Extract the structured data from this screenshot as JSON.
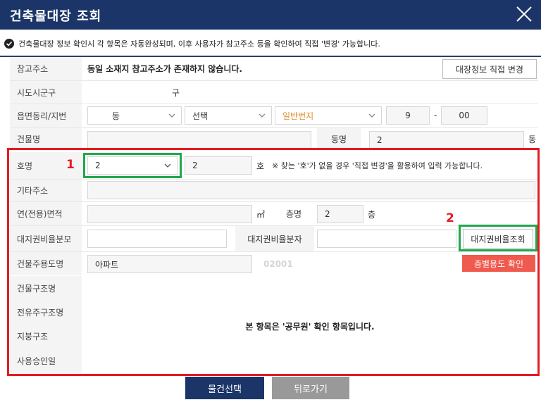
{
  "window": {
    "title": "건축물대장 조회",
    "close_icon": "close-icon"
  },
  "notice": "건축물대장 정보 확인시 각 항목은 자동완성되며, 이후 사용자가 참고주소 등을 확인하여 직접 '변경' 가능합니다.",
  "rows": {
    "ref_address": {
      "label": "참고주소",
      "value": "동일 소재지 참고주소가 존재하지 않습니다.",
      "button": "대장정보 직접 변경"
    },
    "sido": {
      "label": "시도시군구",
      "value": "구"
    },
    "eup": {
      "label": "읍면동리/지번",
      "dong_select": "동",
      "type_select": "선택",
      "lot_select": "일반번지",
      "main_no": "9",
      "dash": "-",
      "sub_no": "00"
    },
    "building_name": {
      "label": "건물명",
      "value": "",
      "dong_label": "동명",
      "dong_value": "2",
      "dong_suffix": "동"
    },
    "ho": {
      "label": "호명",
      "select_value": "2",
      "input_value": "2",
      "suffix": "호",
      "hint": "※ 찾는 '호'가 없을 경우 '직접 변경'을 활용하여 입력 가능합니다."
    },
    "etc_address": {
      "label": "기타주소",
      "value": ""
    },
    "area": {
      "label": "연(전용)면적",
      "value": "",
      "unit": "㎡",
      "floor_label": "층명",
      "floor_value": "2",
      "floor_suffix": "층"
    },
    "land_denominator": {
      "label": "대지권비율분모",
      "value": "",
      "numerator_label": "대지권비율분자",
      "numerator_value": "",
      "button": "대지권비율조회"
    },
    "usage": {
      "label": "건물주용도명",
      "value": "아파트",
      "code": "02001",
      "button": "층별용도 확인"
    },
    "structure": {
      "label": "건물구조명"
    },
    "exclusive_structure": {
      "label": "전유주구조명"
    },
    "roof": {
      "label": "지붕구조"
    },
    "approval_date": {
      "label": "사용승인일"
    },
    "official_notice": "본 항목은 '공무원' 확인 항목입니다."
  },
  "markers": {
    "one": "1",
    "two": "2"
  },
  "footer": {
    "select_button": "물건선택",
    "back_button": "뒤로가기"
  },
  "colors": {
    "navy": "#1c3568",
    "red_highlight": "#e31b23",
    "green_highlight": "#1fa84a",
    "red_button": "#f05a4e",
    "orange_text": "#e08a2c"
  }
}
